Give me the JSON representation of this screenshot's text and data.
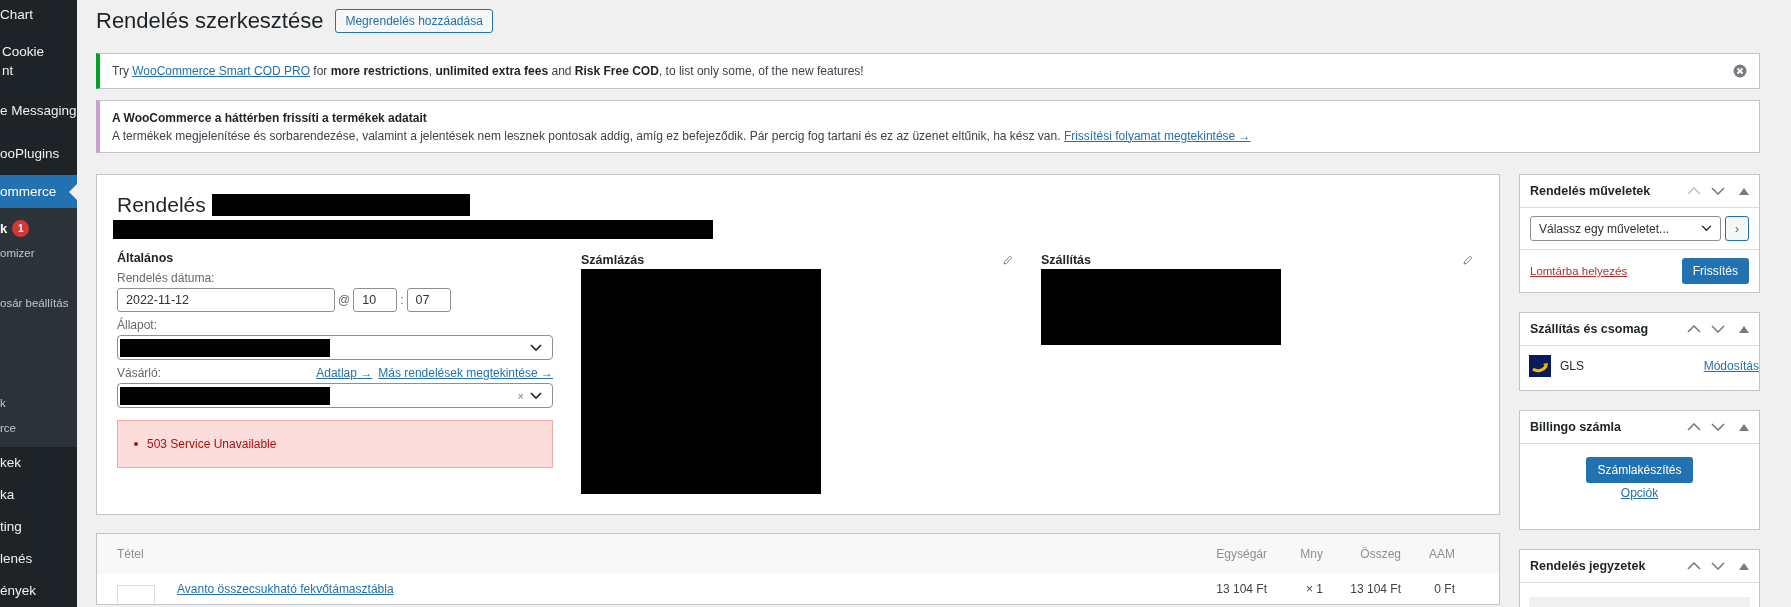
{
  "sidebar": {
    "items": [
      {
        "lines": [
          "Chart"
        ],
        "selected": false
      },
      {
        "lines": [
          "Cookie",
          "nt"
        ],
        "selected": false
      },
      {
        "lines": [
          "e Messaging"
        ],
        "selected": false
      },
      {
        "lines": [
          "ooPlugins"
        ],
        "selected": false
      },
      {
        "lines": [
          "ommerce"
        ],
        "selected": true,
        "children": [
          {
            "label": "k",
            "badge": "1"
          },
          {
            "label": "omizer"
          },
          {
            "label": "osár beállítás"
          },
          {
            "label": "k"
          },
          {
            "label": "rce"
          }
        ]
      },
      {
        "lines": [
          "kek"
        ],
        "selected": false
      },
      {
        "lines": [
          "ka"
        ],
        "selected": false
      },
      {
        "lines": [
          "ting"
        ],
        "selected": false
      },
      {
        "lines": [
          "lenés"
        ],
        "selected": false
      },
      {
        "lines": [
          "ények"
        ],
        "selected": false
      }
    ]
  },
  "page_title": "Rendelés szerkesztése",
  "add_button": "Megrendelés hozzáadása",
  "notices": [
    {
      "kind": "promo",
      "prefix": "Try ",
      "link": "WooCommerce Smart COD PRO",
      "text": " for **more restrictions**, **unlimited extra fees** and **Risk Free COD**, to list only some, of the new features!",
      "dismissible": true
    },
    {
      "kind": "info",
      "title": "A WooCommerce a háttérben frissíti a termékek adatait",
      "text": "A termékek megjelenítése és sorbarendezése, valamint a jelentések nem lesznek pontosak addig, amíg ez befejeződik. Pár percig fog tartani és ez az üzenet eltűnik, ha kész van. ",
      "link": "Frissítési folyamat megtekintése →",
      "dismissible": false
    }
  ],
  "order": {
    "heading": "Rendelés",
    "general": {
      "title": "Általános",
      "date_label": "Rendelés dátuma:",
      "date": "2022-11-12",
      "at": "@",
      "hour": "10",
      "colon": ":",
      "minute": "07",
      "status_label": "Állapot:",
      "customer_label": "Vásárló:",
      "customer_links": [
        "Adatlap →",
        "Más rendelések megtekintése →"
      ],
      "clear": "×",
      "errors": [
        "503 Service Unavailable"
      ]
    },
    "billing": {
      "title": "Számlázás"
    },
    "shipping": {
      "title": "Szállítás"
    }
  },
  "sideboxes": [
    {
      "kind": "actions",
      "title": "Rendelés műveletek",
      "select": "Válassz egy műveletet...",
      "go": "›",
      "trash": "Lomtárba helyezés",
      "button": "Frissítés",
      "can_move_up": false
    },
    {
      "kind": "carrier",
      "title": "Szállítás és csomag",
      "carrier": "GLS",
      "link": "Módosítás",
      "can_move_up": true
    },
    {
      "kind": "invoice",
      "title": "Billingo számla",
      "button": "Számlakészítés",
      "link": "Opciók",
      "can_move_up": true
    },
    {
      "kind": "notes",
      "title": "Rendelés jegyzetek",
      "can_move_up": true
    }
  ],
  "items": {
    "columns": [
      "Tétel",
      "Egységár",
      "Mny",
      "Összeg",
      "AAM"
    ],
    "rows": [
      {
        "name": "Avanto összecsukható fekvőtámasztábla",
        "price": "13 104 Ft",
        "qty": "× 1",
        "total": "13 104 Ft",
        "tax": "0 Ft"
      }
    ]
  }
}
